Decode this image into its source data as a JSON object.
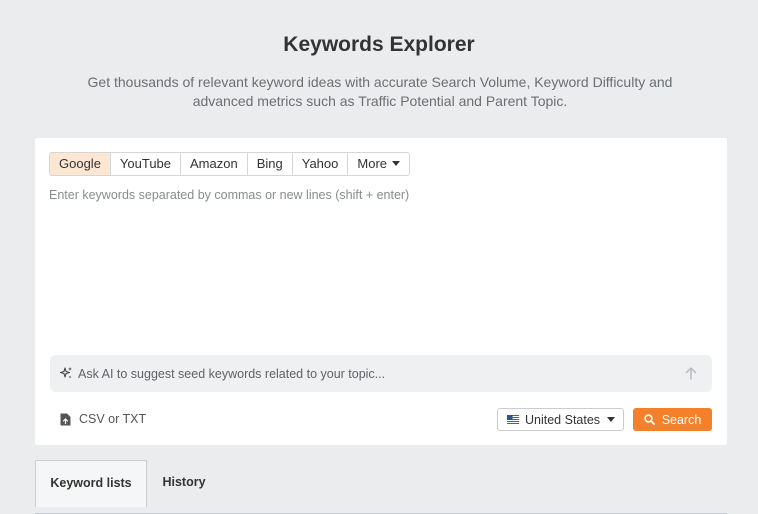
{
  "header": {
    "title": "Keywords Explorer",
    "subtitle": "Get thousands of relevant keyword ideas with accurate Search Volume, Keyword Difficulty and advanced metrics such as Traffic Potential and Parent Topic."
  },
  "engines": {
    "items": [
      {
        "label": "Google",
        "active": true
      },
      {
        "label": "YouTube",
        "active": false
      },
      {
        "label": "Amazon",
        "active": false
      },
      {
        "label": "Bing",
        "active": false
      },
      {
        "label": "Yahoo",
        "active": false
      }
    ],
    "more_label": "More"
  },
  "keywords_input": {
    "value": "",
    "placeholder": "Enter keywords separated by commas or new lines (shift + enter)"
  },
  "ai_bar": {
    "placeholder": "Ask AI to suggest seed keywords related to your topic...",
    "sparkle_icon": "sparkle-icon",
    "send_icon": "arrow-up-icon"
  },
  "upload": {
    "label": "CSV or TXT",
    "icon": "file-upload-icon"
  },
  "country": {
    "selected": "United States",
    "flag_icon": "us-flag-icon"
  },
  "search_button": {
    "label": "Search",
    "icon": "search-icon",
    "color": "#f5802a"
  },
  "tabs": [
    {
      "label": "Keyword lists",
      "active": true
    },
    {
      "label": "History",
      "active": false
    }
  ],
  "colors": {
    "accent": "#f5802a",
    "active_engine_bg": "#fde7d3",
    "page_bg": "#ebecee"
  }
}
